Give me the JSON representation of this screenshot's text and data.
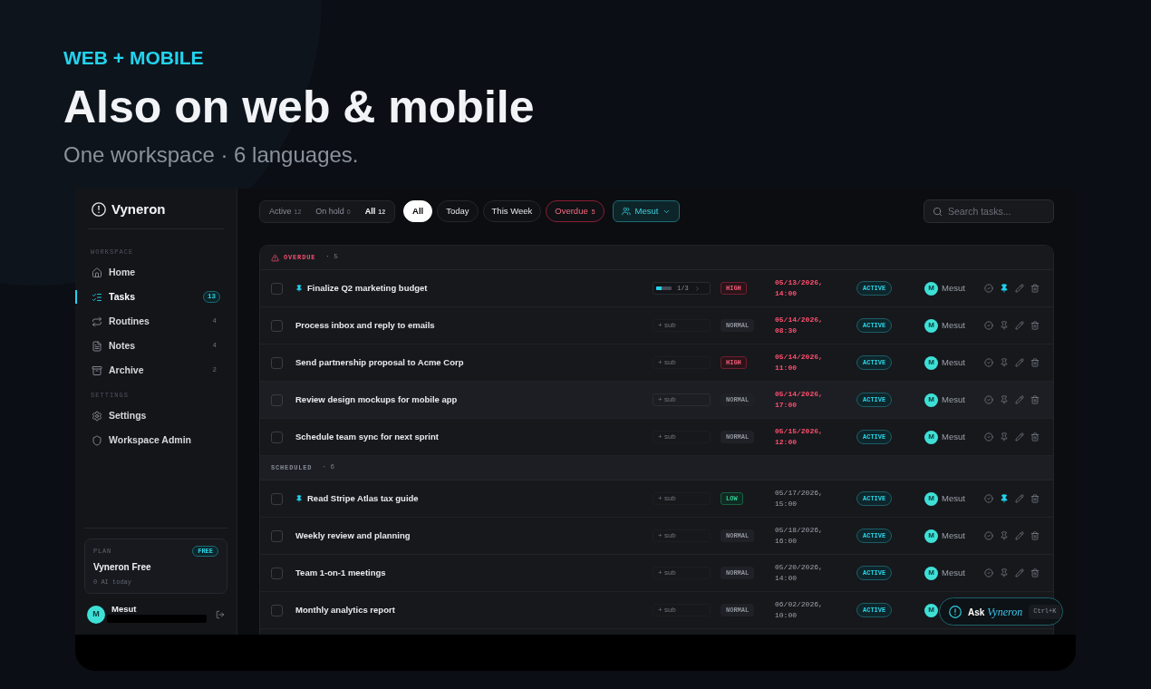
{
  "hero": {
    "eyebrow": "WEB + MOBILE",
    "title": "Also on web & mobile",
    "subtitle": "One workspace · 6 languages."
  },
  "sidebar": {
    "brand": "Vyneron",
    "sections": [
      {
        "label": "WORKSPACE",
        "items": [
          {
            "label": "Home",
            "selected": false
          },
          {
            "label": "Tasks",
            "count": "13",
            "selected": true
          },
          {
            "label": "Routines",
            "count": "4",
            "selected": false
          },
          {
            "label": "Notes",
            "count": "4",
            "selected": false
          },
          {
            "label": "Archive",
            "count": "2",
            "selected": false
          }
        ]
      },
      {
        "label": "SETTINGS",
        "items": [
          {
            "label": "Settings",
            "selected": false
          },
          {
            "label": "Workspace Admin",
            "selected": false
          }
        ]
      }
    ],
    "plan": {
      "label": "PLAN",
      "badge": "FREE",
      "name": "Vyneron Free",
      "usage": "0 AI today"
    },
    "user": {
      "initial": "M",
      "name": "Mesut"
    }
  },
  "toolbar": {
    "scopes": [
      {
        "label": "Active",
        "count": "12",
        "selected": false
      },
      {
        "label": "On hold",
        "count": "0",
        "selected": false
      },
      {
        "label": "All",
        "count": "12",
        "selected": true
      }
    ],
    "filters": [
      {
        "label": "All",
        "kind": "plain",
        "selected": true
      },
      {
        "label": "Today",
        "kind": "plain",
        "selected": false
      },
      {
        "label": "This Week",
        "kind": "plain",
        "selected": false
      },
      {
        "label": "Overdue",
        "count": "5",
        "kind": "danger",
        "selected": false
      }
    ],
    "assignee": {
      "label": "Mesut"
    },
    "search": {
      "placeholder": "Search tasks..."
    }
  },
  "task_groups": [
    {
      "kind": "overdue",
      "label": "OVERDUE",
      "count": "· 5",
      "rows": [
        {
          "title": "Finalize Q2 marketing budget",
          "checked": false,
          "pinned": true,
          "hovered": false,
          "subtasks": {
            "kind": "progress",
            "level": 0.33,
            "label": "1/3"
          },
          "priority": {
            "kind": "high",
            "label": "HIGH"
          },
          "due": "05/13/2026, 14:00",
          "status": "ACTIVE",
          "assignee": {
            "initial": "M",
            "name": "Mesut"
          },
          "actions": [
            {
              "kind": "complete"
            },
            {
              "kind": "pin"
            },
            {
              "kind": "edit"
            },
            {
              "kind": "delete"
            }
          ]
        },
        {
          "title": "Process inbox and reply to emails",
          "checked": false,
          "pinned": false,
          "hovered": false,
          "subtasks": {
            "kind": "add",
            "label": "+ sub"
          },
          "priority": {
            "kind": "normal",
            "label": "NORMAL"
          },
          "due": "05/14/2026, 08:30",
          "status": "ACTIVE",
          "assignee": {
            "initial": "M",
            "name": "Mesut"
          },
          "actions": [
            {
              "kind": "complete"
            },
            {
              "kind": "pin"
            },
            {
              "kind": "edit"
            },
            {
              "kind": "delete"
            }
          ]
        },
        {
          "title": "Send partnership proposal to Acme Corp",
          "checked": false,
          "pinned": false,
          "hovered": false,
          "subtasks": {
            "kind": "add",
            "label": "+ sub"
          },
          "priority": {
            "kind": "high",
            "label": "HIGH"
          },
          "due": "05/14/2026, 11:00",
          "status": "ACTIVE",
          "assignee": {
            "initial": "M",
            "name": "Mesut"
          },
          "actions": [
            {
              "kind": "complete"
            },
            {
              "kind": "pin"
            },
            {
              "kind": "edit"
            },
            {
              "kind": "delete"
            }
          ]
        },
        {
          "title": "Review design mockups for mobile app",
          "checked": false,
          "pinned": false,
          "hovered": true,
          "subtasks": {
            "kind": "add",
            "label": "+ sub"
          },
          "priority": {
            "kind": "normal",
            "label": "NORMAL"
          },
          "due": "05/14/2026, 17:00",
          "status": "ACTIVE",
          "assignee": {
            "initial": "M",
            "name": "Mesut"
          },
          "actions": [
            {
              "kind": "complete"
            },
            {
              "kind": "pin"
            },
            {
              "kind": "edit"
            },
            {
              "kind": "delete"
            }
          ]
        },
        {
          "title": "Schedule team sync for next sprint",
          "checked": false,
          "pinned": false,
          "hovered": false,
          "subtasks": {
            "kind": "add",
            "label": "+ sub"
          },
          "priority": {
            "kind": "normal",
            "label": "NORMAL"
          },
          "due": "05/15/2026, 12:00",
          "status": "ACTIVE",
          "assignee": {
            "initial": "M",
            "name": "Mesut"
          },
          "actions": [
            {
              "kind": "complete"
            },
            {
              "kind": "pin"
            },
            {
              "kind": "edit"
            },
            {
              "kind": "delete"
            }
          ]
        }
      ]
    },
    {
      "kind": "scheduled",
      "label": "SCHEDULED",
      "count": "· 6",
      "rows": [
        {
          "title": "Read Stripe Atlas tax guide",
          "checked": false,
          "pinned": true,
          "hovered": false,
          "subtasks": {
            "kind": "add",
            "label": "+ sub"
          },
          "priority": {
            "kind": "low",
            "label": "LOW"
          },
          "due": "05/17/2026, 15:00",
          "status": "ACTIVE",
          "assignee": {
            "initial": "M",
            "name": "Mesut"
          },
          "actions": [
            {
              "kind": "complete"
            },
            {
              "kind": "pin"
            },
            {
              "kind": "edit"
            },
            {
              "kind": "delete"
            }
          ]
        },
        {
          "title": "Weekly review and planning",
          "checked": false,
          "pinned": false,
          "hovered": false,
          "subtasks": {
            "kind": "add",
            "label": "+ sub"
          },
          "priority": {
            "kind": "normal",
            "label": "NORMAL"
          },
          "due": "05/18/2026, 16:00",
          "status": "ACTIVE",
          "assignee": {
            "initial": "M",
            "name": "Mesut"
          },
          "actions": [
            {
              "kind": "complete"
            },
            {
              "kind": "pin"
            },
            {
              "kind": "edit"
            },
            {
              "kind": "delete"
            }
          ]
        },
        {
          "title": "Team 1-on-1 meetings",
          "checked": false,
          "pinned": false,
          "hovered": false,
          "subtasks": {
            "kind": "add",
            "label": "+ sub"
          },
          "priority": {
            "kind": "normal",
            "label": "NORMAL"
          },
          "due": "05/20/2026, 14:00",
          "status": "ACTIVE",
          "assignee": {
            "initial": "M",
            "name": "Mesut"
          },
          "actions": [
            {
              "kind": "complete"
            },
            {
              "kind": "pin"
            },
            {
              "kind": "edit"
            },
            {
              "kind": "delete"
            }
          ]
        },
        {
          "title": "Monthly analytics report",
          "checked": false,
          "pinned": false,
          "hovered": false,
          "subtasks": {
            "kind": "add",
            "label": "+ sub"
          },
          "priority": {
            "kind": "normal",
            "label": "NORMAL"
          },
          "due": "06/02/2026, 10:00",
          "status": "ACTIVE",
          "assignee": {
            "initial": "M"
          }
        }
      ]
    }
  ],
  "assistant": {
    "label": "Ask *Vyneron*",
    "shortcut": "Ctrl+K"
  }
}
